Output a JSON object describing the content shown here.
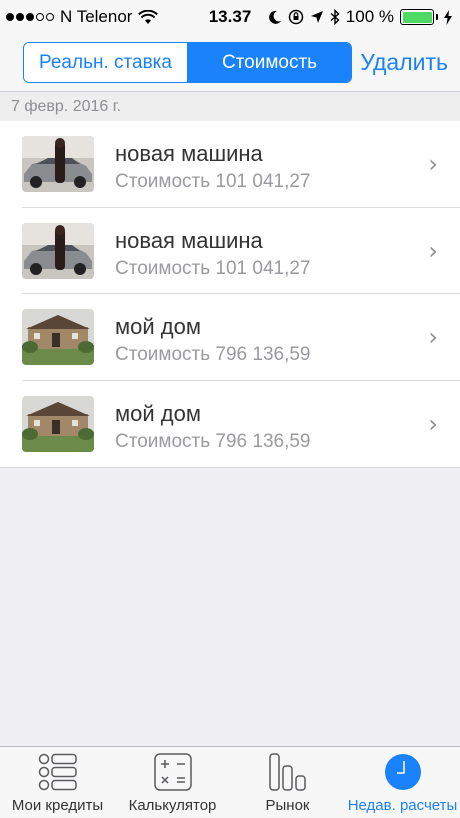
{
  "status_bar": {
    "carrier": "N Telenor",
    "time": "13.37",
    "battery_percent": "100 %",
    "battery_level": 1.0,
    "signal_bars_filled": 3,
    "signal_bars_total": 5
  },
  "nav": {
    "segments": [
      {
        "label": "Реальн. ставка",
        "active": false
      },
      {
        "label": "Стоимость",
        "active": true
      }
    ],
    "delete_label": "Удалить"
  },
  "section": {
    "date": "7 февр. 2016 г."
  },
  "items": [
    {
      "title": "новая машина",
      "subtitle": "Стоимость 101 041,27",
      "thumb": "car-photo"
    },
    {
      "title": "новая машина",
      "subtitle": "Стоимость 101 041,27",
      "thumb": "car-photo"
    },
    {
      "title": "мой дом",
      "subtitle": "Стоимость 796 136,59",
      "thumb": "house-photo"
    },
    {
      "title": "мой дом",
      "subtitle": "Стоимость 796 136,59",
      "thumb": "house-photo"
    }
  ],
  "tabs": [
    {
      "label": "Мои кредиты",
      "icon": "list-icon",
      "active": false
    },
    {
      "label": "Калькулятор",
      "icon": "calculator-icon",
      "active": false
    },
    {
      "label": "Рынок",
      "icon": "bar-chart-icon",
      "active": false
    },
    {
      "label": "Недав. расчеты",
      "icon": "clock-icon",
      "active": true
    }
  ],
  "colors": {
    "accent": "#1a82fb",
    "battery": "#4cd964"
  }
}
